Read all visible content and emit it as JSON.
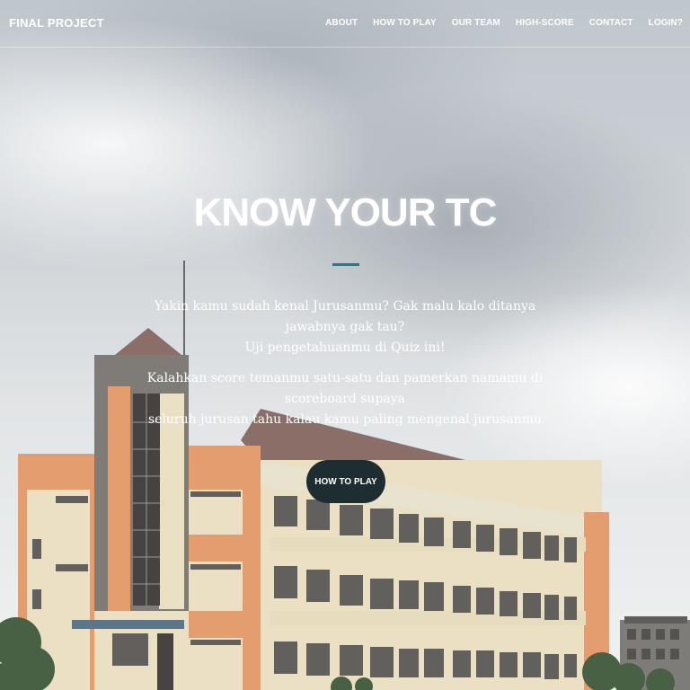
{
  "navbar": {
    "brand": "FINAL PROJECT",
    "links": [
      "ABOUT",
      "HOW TO PLAY",
      "OUR TEAM",
      "HIGH-SCORE",
      "CONTACT",
      "LOGIN?"
    ]
  },
  "hero": {
    "title": "KNOW YOUR TC",
    "text1_line1": "Yakin kamu sudah kenal Jurusanmu? Gak malu kalo ditanya jawabnya gak tau?",
    "text1_line2": "Uji pengetahuanmu di Quiz ini!",
    "text2_line1": "Kalahkan score temanmu satu-satu dan pamerkan namamu di scoreboard supaya",
    "text2_line2": "seluruh jurusan tahu kalau kamu paling mengenal jurusanmu",
    "cta_label": "HOW TO PLAY"
  },
  "colors": {
    "accent": "#1d7f8c",
    "button_bg": "#1e2d32",
    "building_orange": "#e0905c",
    "building_cream": "#e9dcbc",
    "roof": "#7a5a52"
  },
  "icons": {
    "background": "campus-building-photo"
  }
}
